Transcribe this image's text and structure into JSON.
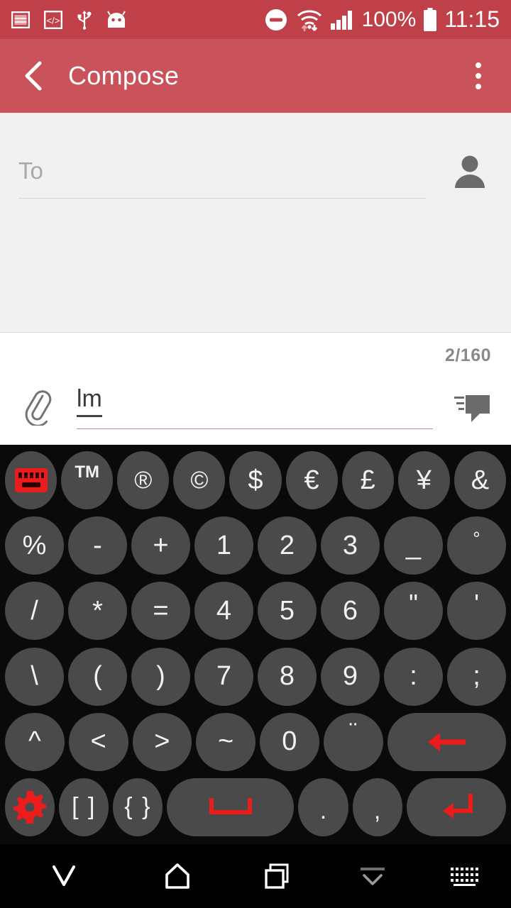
{
  "status_bar": {
    "background": "#bf4048",
    "left_icons": [
      {
        "name": "screenshot-icon",
        "label": "screenshot"
      },
      {
        "name": "code-icon",
        "label": "</>"
      },
      {
        "name": "usb-icon",
        "label": "usb"
      },
      {
        "name": "android-head-icon",
        "label": "android"
      }
    ],
    "dnd_icon": "do-not-disturb-icon",
    "wifi_icon": "wifi-transfer-icon",
    "signal_icon": "cellular-signal-icon",
    "battery_percent": "100%",
    "battery_icon": "battery-full-icon",
    "clock": "11:15"
  },
  "app_bar": {
    "background": "#c9525b",
    "back_icon": "back-chevron-icon",
    "title": "Compose",
    "overflow_icon": "overflow-menu-icon"
  },
  "recipient": {
    "to_placeholder": "To",
    "to_value": "",
    "contact_picker_icon": "contact-person-icon"
  },
  "compose": {
    "char_counter": "2/160",
    "attach_icon": "paperclip-icon",
    "message_value": "lm",
    "message_placeholder": "",
    "send_icon": "send-message-icon",
    "underline_color": "#b98f93"
  },
  "keyboard": {
    "accent_color": "#ec1c1c",
    "key_color": "#4a4a4a",
    "background": "#0a0a0a",
    "rows": [
      [
        {
          "name": "key-switch-keyboard",
          "label": "",
          "icon": "keyboard-icon",
          "type": "icon",
          "accent": true
        },
        {
          "name": "key-trademark",
          "label": "TM",
          "type": "sup"
        },
        {
          "name": "key-registered",
          "label": "®",
          "type": "circ"
        },
        {
          "name": "key-copyright",
          "label": "©",
          "type": "circ"
        },
        {
          "name": "key-dollar",
          "label": "$",
          "type": "char"
        },
        {
          "name": "key-euro",
          "label": "€",
          "type": "char"
        },
        {
          "name": "key-pound",
          "label": "£",
          "type": "char"
        },
        {
          "name": "key-yen",
          "label": "¥",
          "type": "char"
        },
        {
          "name": "key-ampersand",
          "label": "&",
          "type": "char"
        }
      ],
      [
        {
          "name": "key-percent",
          "label": "%",
          "type": "char"
        },
        {
          "name": "key-minus",
          "label": "-",
          "type": "char"
        },
        {
          "name": "key-plus",
          "label": "+",
          "type": "char"
        },
        {
          "name": "key-1",
          "label": "1",
          "type": "char"
        },
        {
          "name": "key-2",
          "label": "2",
          "type": "char"
        },
        {
          "name": "key-3",
          "label": "3",
          "type": "char"
        },
        {
          "name": "key-underscore",
          "label": "_",
          "type": "char"
        },
        {
          "name": "key-degree",
          "label": "°",
          "type": "deg"
        }
      ],
      [
        {
          "name": "key-slash",
          "label": "/",
          "type": "char"
        },
        {
          "name": "key-asterisk",
          "label": "*",
          "type": "char"
        },
        {
          "name": "key-equals",
          "label": "=",
          "type": "char"
        },
        {
          "name": "key-4",
          "label": "4",
          "type": "char"
        },
        {
          "name": "key-5",
          "label": "5",
          "type": "char"
        },
        {
          "name": "key-6",
          "label": "6",
          "type": "char"
        },
        {
          "name": "key-double-quote",
          "label": "\"",
          "type": "quote"
        },
        {
          "name": "key-single-quote",
          "label": "'",
          "type": "quote"
        }
      ],
      [
        {
          "name": "key-backslash",
          "label": "\\",
          "type": "char"
        },
        {
          "name": "key-paren-open",
          "label": "(",
          "type": "char"
        },
        {
          "name": "key-paren-close",
          "label": ")",
          "type": "char"
        },
        {
          "name": "key-7",
          "label": "7",
          "type": "char"
        },
        {
          "name": "key-8",
          "label": "8",
          "type": "char"
        },
        {
          "name": "key-9",
          "label": "9",
          "type": "char"
        },
        {
          "name": "key-colon",
          "label": ":",
          "type": "char"
        },
        {
          "name": "key-semicolon",
          "label": ";",
          "type": "char"
        }
      ],
      [
        {
          "name": "key-caret",
          "label": "^",
          "type": "char"
        },
        {
          "name": "key-less-than",
          "label": "<",
          "type": "char"
        },
        {
          "name": "key-greater-than",
          "label": ">",
          "type": "char"
        },
        {
          "name": "key-tilde",
          "label": "~",
          "type": "char"
        },
        {
          "name": "key-0",
          "label": "0",
          "type": "char"
        },
        {
          "name": "key-diaeresis",
          "label": "¨",
          "type": "umlaut"
        },
        {
          "name": "key-backspace",
          "label": "",
          "icon": "backspace-arrow-icon",
          "type": "icon-wide",
          "accent": true
        }
      ],
      [
        {
          "name": "key-settings",
          "label": "",
          "icon": "gear-icon",
          "type": "icon",
          "accent": true
        },
        {
          "name": "key-square-brackets",
          "label": "[ ]",
          "type": "brackets"
        },
        {
          "name": "key-curly-brackets",
          "label": "{ }",
          "type": "brackets"
        },
        {
          "name": "key-space",
          "label": "",
          "icon": "space-icon",
          "type": "icon-space",
          "accent": true
        },
        {
          "name": "key-period",
          "label": ".",
          "type": "dot"
        },
        {
          "name": "key-comma",
          "label": ",",
          "type": "dot"
        },
        {
          "name": "key-enter",
          "label": "",
          "icon": "enter-arrow-icon",
          "type": "icon-wide",
          "accent": true
        }
      ]
    ]
  },
  "nav_bar": {
    "back_icon": "back-down-chevron-icon",
    "home_icon": "home-icon",
    "recents_icon": "recents-icon",
    "hide_keyboard_icon": "hide-keyboard-chevron-icon",
    "keyboard_switch_icon": "keyboard-switcher-icon"
  }
}
